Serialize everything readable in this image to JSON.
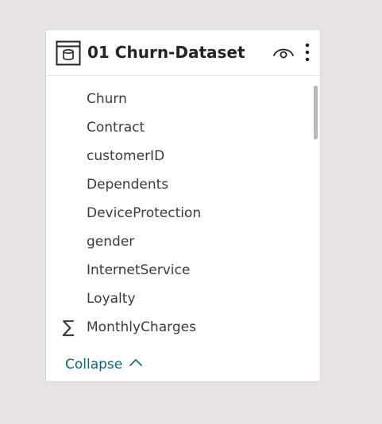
{
  "table": {
    "title": "01 Churn-Dataset",
    "icon": "table-icon"
  },
  "header_actions": {
    "visibility_icon": "eye-icon",
    "more_icon": "more-options-icon"
  },
  "fields": [
    {
      "label": "Churn",
      "icon": ""
    },
    {
      "label": "Contract",
      "icon": ""
    },
    {
      "label": "customerID",
      "icon": ""
    },
    {
      "label": "Dependents",
      "icon": ""
    },
    {
      "label": "DeviceProtection",
      "icon": ""
    },
    {
      "label": "gender",
      "icon": ""
    },
    {
      "label": "InternetService",
      "icon": ""
    },
    {
      "label": "Loyalty",
      "icon": ""
    },
    {
      "label": "MonthlyCharges",
      "icon": "sum-icon",
      "icon_glyph": "∑"
    }
  ],
  "footer": {
    "collapse_label": "Collapse"
  },
  "colors": {
    "background": "#e5e4e2",
    "card": "#ffffff",
    "accent": "#0e6674",
    "text": "#252423"
  }
}
